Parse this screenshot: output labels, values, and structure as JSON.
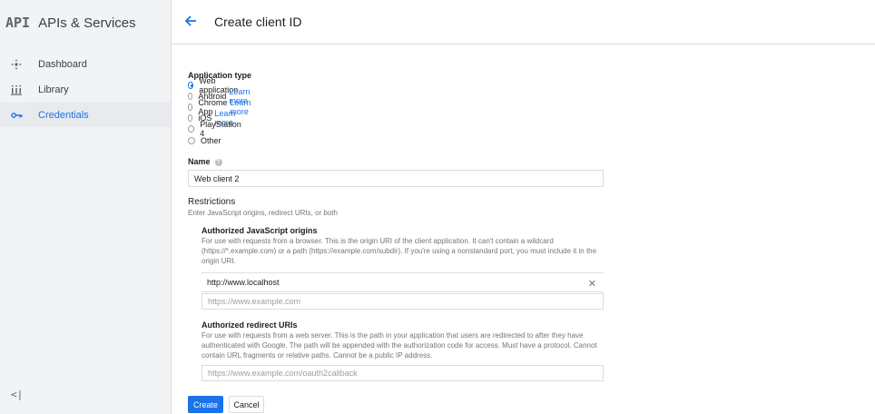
{
  "brand": {
    "logo": "API",
    "title": "APIs & Services"
  },
  "sidebar": {
    "items": [
      {
        "label": "Dashboard",
        "icon": "dashboard-icon"
      },
      {
        "label": "Library",
        "icon": "library-icon"
      },
      {
        "label": "Credentials",
        "icon": "key-icon",
        "active": true
      }
    ],
    "collapse": "<|"
  },
  "header": {
    "title": "Create client ID"
  },
  "form": {
    "app_type_label": "Application type",
    "app_types": [
      {
        "label": "Web application",
        "checked": true,
        "link": ""
      },
      {
        "label": "Android",
        "link": "Learn more"
      },
      {
        "label": "Chrome App",
        "link": "Learn more"
      },
      {
        "label": "iOS",
        "link": "Learn more"
      },
      {
        "label": "PlayStation 4",
        "link": ""
      },
      {
        "label": "Other",
        "link": ""
      }
    ],
    "name_label": "Name",
    "name_value": "Web client 2",
    "restrictions_title": "Restrictions",
    "restrictions_subtitle": "Enter JavaScript origins, redirect URIs, or both",
    "js_origins_title": "Authorized JavaScript origins",
    "js_origins_help": "For use with requests from a browser. This is the origin URI of the client application. It can't contain a wildcard (https://*.example.com) or a path (https://example.com/subdir). If you're using a nonstandard port, you must include it in the origin URI.",
    "js_origin_value": "http://www.localhost",
    "js_origin_placeholder": "https://www.example.com",
    "redirect_title": "Authorized redirect URIs",
    "redirect_help": "For use with requests from a web server. This is the path in your application that users are redirected to after they have authenticated with Google. The path will be appended with the authorization code for access. Must have a protocol. Cannot contain URL fragments or relative paths. Cannot be a public IP address.",
    "redirect_placeholder": "https://www.example.com/oauth2callback",
    "create_label": "Create",
    "cancel_label": "Cancel"
  },
  "colors": {
    "accent": "#1a73e8",
    "sidebar_bg": "#f1f3f4"
  }
}
